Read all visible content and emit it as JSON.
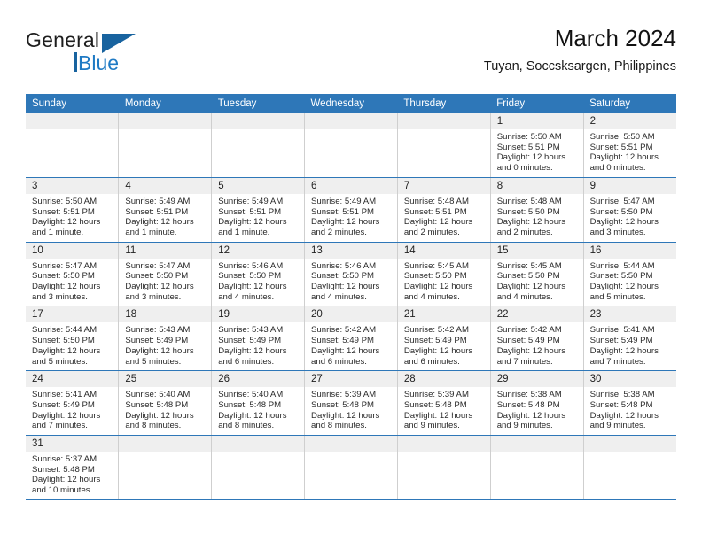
{
  "brand": {
    "name_part1": "General",
    "name_part2": "Blue",
    "logo_icon": "triangle-flag-icon"
  },
  "header": {
    "title": "March 2024",
    "subtitle": "Tuyan, Soccsksargen, Philippines"
  },
  "colors": {
    "header_blue": "#2E77B8",
    "brand_blue": "#1F7AC4",
    "daynum_gray": "#EFEFEF"
  },
  "calendar": {
    "weekday_headers": [
      "Sunday",
      "Monday",
      "Tuesday",
      "Wednesday",
      "Thursday",
      "Friday",
      "Saturday"
    ],
    "weeks": [
      [
        {
          "day": "",
          "lines": []
        },
        {
          "day": "",
          "lines": []
        },
        {
          "day": "",
          "lines": []
        },
        {
          "day": "",
          "lines": []
        },
        {
          "day": "",
          "lines": []
        },
        {
          "day": "1",
          "lines": [
            "Sunrise: 5:50 AM",
            "Sunset: 5:51 PM",
            "Daylight: 12 hours",
            "and 0 minutes."
          ]
        },
        {
          "day": "2",
          "lines": [
            "Sunrise: 5:50 AM",
            "Sunset: 5:51 PM",
            "Daylight: 12 hours",
            "and 0 minutes."
          ]
        }
      ],
      [
        {
          "day": "3",
          "lines": [
            "Sunrise: 5:50 AM",
            "Sunset: 5:51 PM",
            "Daylight: 12 hours",
            "and 1 minute."
          ]
        },
        {
          "day": "4",
          "lines": [
            "Sunrise: 5:49 AM",
            "Sunset: 5:51 PM",
            "Daylight: 12 hours",
            "and 1 minute."
          ]
        },
        {
          "day": "5",
          "lines": [
            "Sunrise: 5:49 AM",
            "Sunset: 5:51 PM",
            "Daylight: 12 hours",
            "and 1 minute."
          ]
        },
        {
          "day": "6",
          "lines": [
            "Sunrise: 5:49 AM",
            "Sunset: 5:51 PM",
            "Daylight: 12 hours",
            "and 2 minutes."
          ]
        },
        {
          "day": "7",
          "lines": [
            "Sunrise: 5:48 AM",
            "Sunset: 5:51 PM",
            "Daylight: 12 hours",
            "and 2 minutes."
          ]
        },
        {
          "day": "8",
          "lines": [
            "Sunrise: 5:48 AM",
            "Sunset: 5:50 PM",
            "Daylight: 12 hours",
            "and 2 minutes."
          ]
        },
        {
          "day": "9",
          "lines": [
            "Sunrise: 5:47 AM",
            "Sunset: 5:50 PM",
            "Daylight: 12 hours",
            "and 3 minutes."
          ]
        }
      ],
      [
        {
          "day": "10",
          "lines": [
            "Sunrise: 5:47 AM",
            "Sunset: 5:50 PM",
            "Daylight: 12 hours",
            "and 3 minutes."
          ]
        },
        {
          "day": "11",
          "lines": [
            "Sunrise: 5:47 AM",
            "Sunset: 5:50 PM",
            "Daylight: 12 hours",
            "and 3 minutes."
          ]
        },
        {
          "day": "12",
          "lines": [
            "Sunrise: 5:46 AM",
            "Sunset: 5:50 PM",
            "Daylight: 12 hours",
            "and 4 minutes."
          ]
        },
        {
          "day": "13",
          "lines": [
            "Sunrise: 5:46 AM",
            "Sunset: 5:50 PM",
            "Daylight: 12 hours",
            "and 4 minutes."
          ]
        },
        {
          "day": "14",
          "lines": [
            "Sunrise: 5:45 AM",
            "Sunset: 5:50 PM",
            "Daylight: 12 hours",
            "and 4 minutes."
          ]
        },
        {
          "day": "15",
          "lines": [
            "Sunrise: 5:45 AM",
            "Sunset: 5:50 PM",
            "Daylight: 12 hours",
            "and 4 minutes."
          ]
        },
        {
          "day": "16",
          "lines": [
            "Sunrise: 5:44 AM",
            "Sunset: 5:50 PM",
            "Daylight: 12 hours",
            "and 5 minutes."
          ]
        }
      ],
      [
        {
          "day": "17",
          "lines": [
            "Sunrise: 5:44 AM",
            "Sunset: 5:50 PM",
            "Daylight: 12 hours",
            "and 5 minutes."
          ]
        },
        {
          "day": "18",
          "lines": [
            "Sunrise: 5:43 AM",
            "Sunset: 5:49 PM",
            "Daylight: 12 hours",
            "and 5 minutes."
          ]
        },
        {
          "day": "19",
          "lines": [
            "Sunrise: 5:43 AM",
            "Sunset: 5:49 PM",
            "Daylight: 12 hours",
            "and 6 minutes."
          ]
        },
        {
          "day": "20",
          "lines": [
            "Sunrise: 5:42 AM",
            "Sunset: 5:49 PM",
            "Daylight: 12 hours",
            "and 6 minutes."
          ]
        },
        {
          "day": "21",
          "lines": [
            "Sunrise: 5:42 AM",
            "Sunset: 5:49 PM",
            "Daylight: 12 hours",
            "and 6 minutes."
          ]
        },
        {
          "day": "22",
          "lines": [
            "Sunrise: 5:42 AM",
            "Sunset: 5:49 PM",
            "Daylight: 12 hours",
            "and 7 minutes."
          ]
        },
        {
          "day": "23",
          "lines": [
            "Sunrise: 5:41 AM",
            "Sunset: 5:49 PM",
            "Daylight: 12 hours",
            "and 7 minutes."
          ]
        }
      ],
      [
        {
          "day": "24",
          "lines": [
            "Sunrise: 5:41 AM",
            "Sunset: 5:49 PM",
            "Daylight: 12 hours",
            "and 7 minutes."
          ]
        },
        {
          "day": "25",
          "lines": [
            "Sunrise: 5:40 AM",
            "Sunset: 5:48 PM",
            "Daylight: 12 hours",
            "and 8 minutes."
          ]
        },
        {
          "day": "26",
          "lines": [
            "Sunrise: 5:40 AM",
            "Sunset: 5:48 PM",
            "Daylight: 12 hours",
            "and 8 minutes."
          ]
        },
        {
          "day": "27",
          "lines": [
            "Sunrise: 5:39 AM",
            "Sunset: 5:48 PM",
            "Daylight: 12 hours",
            "and 8 minutes."
          ]
        },
        {
          "day": "28",
          "lines": [
            "Sunrise: 5:39 AM",
            "Sunset: 5:48 PM",
            "Daylight: 12 hours",
            "and 9 minutes."
          ]
        },
        {
          "day": "29",
          "lines": [
            "Sunrise: 5:38 AM",
            "Sunset: 5:48 PM",
            "Daylight: 12 hours",
            "and 9 minutes."
          ]
        },
        {
          "day": "30",
          "lines": [
            "Sunrise: 5:38 AM",
            "Sunset: 5:48 PM",
            "Daylight: 12 hours",
            "and 9 minutes."
          ]
        }
      ],
      [
        {
          "day": "31",
          "lines": [
            "Sunrise: 5:37 AM",
            "Sunset: 5:48 PM",
            "Daylight: 12 hours",
            "and 10 minutes."
          ]
        },
        {
          "day": "",
          "lines": []
        },
        {
          "day": "",
          "lines": []
        },
        {
          "day": "",
          "lines": []
        },
        {
          "day": "",
          "lines": []
        },
        {
          "day": "",
          "lines": []
        },
        {
          "day": "",
          "lines": []
        }
      ]
    ]
  }
}
